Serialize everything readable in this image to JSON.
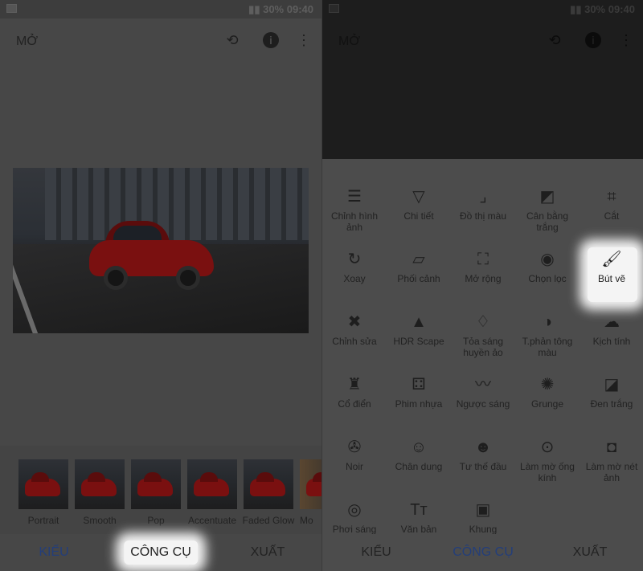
{
  "status_bar": {
    "battery": "30%",
    "time": "09:40"
  },
  "left": {
    "toolbar": {
      "title": "MỞ",
      "icons": [
        "undo-layers-icon",
        "info-icon",
        "more-vert-icon"
      ]
    },
    "filters": [
      {
        "label": "Portrait"
      },
      {
        "label": "Smooth"
      },
      {
        "label": "Pop"
      },
      {
        "label": "Accentuate"
      },
      {
        "label": "Faded Glow"
      },
      {
        "label": "Mo"
      }
    ],
    "nav": {
      "styles": "KIỂU",
      "tools": "CÔNG CỤ",
      "export": "XUẤT",
      "active": "styles",
      "highlighted": "tools"
    }
  },
  "right": {
    "toolbar": {
      "title": "MỞ"
    },
    "tools": [
      {
        "label": "Chỉnh hình ảnh",
        "icon": "tune-icon",
        "glyph": "☰"
      },
      {
        "label": "Chi tiết",
        "icon": "details-triangle-icon",
        "glyph": "▽"
      },
      {
        "label": "Đồ thị màu",
        "icon": "curves-icon",
        "glyph": "⌟"
      },
      {
        "label": "Cân bằng trắng",
        "icon": "white-balance-icon",
        "glyph": "◩"
      },
      {
        "label": "Cắt",
        "icon": "crop-icon",
        "glyph": "⌗"
      },
      {
        "label": "Xoay",
        "icon": "rotate-icon",
        "glyph": "↻"
      },
      {
        "label": "Phối cảnh",
        "icon": "perspective-icon",
        "glyph": "▱"
      },
      {
        "label": "Mở rộng",
        "icon": "expand-icon",
        "glyph": "⛶"
      },
      {
        "label": "Chọn lọc",
        "icon": "selective-icon",
        "glyph": "◉"
      },
      {
        "label": "Bút vẽ",
        "icon": "brush-icon",
        "glyph": "🖌"
      },
      {
        "label": "Chỉnh sửa",
        "icon": "healing-icon",
        "glyph": "✖"
      },
      {
        "label": "HDR Scape",
        "icon": "mountains-icon",
        "glyph": "▲"
      },
      {
        "label": "Tỏa sáng huyền ảo",
        "icon": "glamour-glow-icon",
        "glyph": "♢"
      },
      {
        "label": "T.phản tông màu",
        "icon": "tonal-contrast-icon",
        "glyph": "◑"
      },
      {
        "label": "Kịch tính",
        "icon": "drama-cloud-icon",
        "glyph": "☁"
      },
      {
        "label": "Cổ điển",
        "icon": "lamp-icon",
        "glyph": "♜"
      },
      {
        "label": "Phim nhựa",
        "icon": "grainy-film-icon",
        "glyph": "⚃"
      },
      {
        "label": "Ngược sáng",
        "icon": "mustache-icon",
        "glyph": "〰"
      },
      {
        "label": "Grunge",
        "icon": "grunge-icon",
        "glyph": "✺"
      },
      {
        "label": "Đen trắng",
        "icon": "black-white-icon",
        "glyph": "◪"
      },
      {
        "label": "Noir",
        "icon": "film-reel-icon",
        "glyph": "✇"
      },
      {
        "label": "Chân dung",
        "icon": "face-icon",
        "glyph": "☺"
      },
      {
        "label": "Tư thế đầu",
        "icon": "head-pose-icon",
        "glyph": "☻"
      },
      {
        "label": "Làm mờ ống kính",
        "icon": "lens-blur-icon",
        "glyph": "⊙"
      },
      {
        "label": "Làm mờ nét ảnh",
        "icon": "vignette-icon",
        "glyph": "◘"
      },
      {
        "label": "Phơi sáng",
        "icon": "double-exposure-icon",
        "glyph": "◎"
      },
      {
        "label": "Văn bản",
        "icon": "text-icon",
        "glyph": "Tт"
      },
      {
        "label": "Khung",
        "icon": "frame-icon",
        "glyph": "▣"
      }
    ],
    "highlighted_tool": "Bút vẽ",
    "nav": {
      "styles": "KIỂU",
      "tools": "CÔNG CỤ",
      "export": "XUẤT",
      "active": "tools"
    }
  },
  "colors": {
    "active_nav": "#233e7a",
    "highlight": "#f4f4f4"
  }
}
